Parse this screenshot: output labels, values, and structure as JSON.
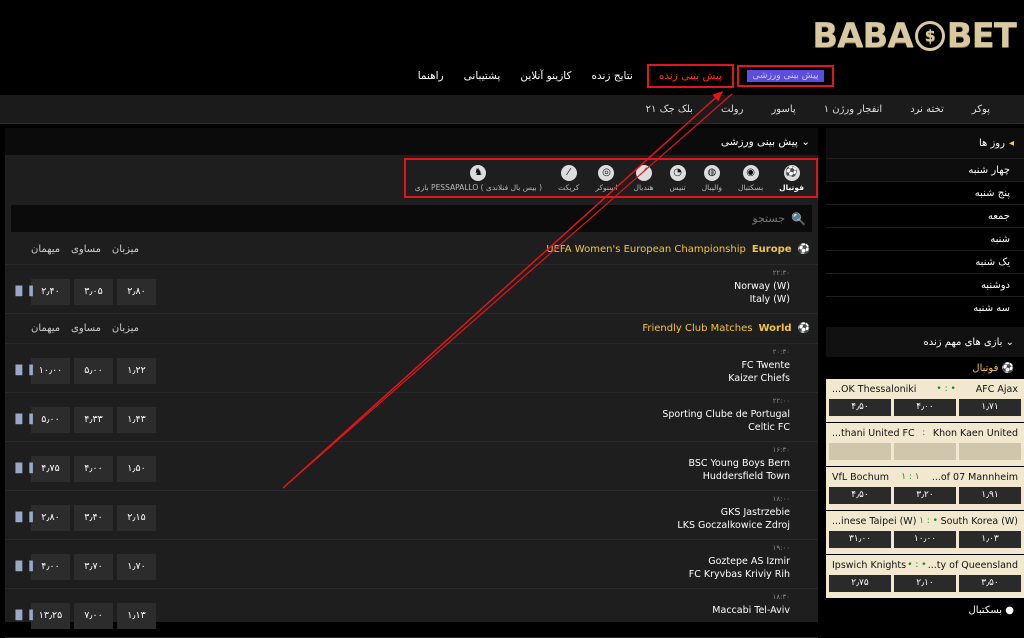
{
  "logo": {
    "left": "BABA",
    "coin": "$",
    "right": "BET"
  },
  "mainnav": {
    "sport": "پیش بینی ورزشی",
    "live": "پیش بینی زنده",
    "results": "نتایج زنده",
    "casino": "کازینو آنلاین",
    "support": "پشتیبانی",
    "help": "راهنما"
  },
  "subnav": [
    "پوکر",
    "تخته نرد",
    "انفجار ورژن ۱",
    "پاسور",
    "رولت",
    "بلک جک ۲۱"
  ],
  "sidebar": {
    "days_title": "روز ها",
    "days": [
      "چهار شنبه",
      "پنج شنبه",
      "جمعه",
      "شنبه",
      "یک شنبه",
      "دوشنبه",
      "سه شنبه"
    ],
    "live_title": "بازی های مهم زنده",
    "live_sport": "فوتبال",
    "live_matches": [
      {
        "home": "AFC Ajax",
        "score": "• : •",
        "away": "...OK Thessaloniki",
        "odds": [
          "۱٫۷۱",
          "۴٫۰۰",
          "۴٫۵۰"
        ]
      },
      {
        "home": "Khon Kaen United",
        "score": ":",
        "away": "...thani United FC",
        "odds": [
          "",
          "",
          ""
        ]
      },
      {
        "home": "...of 07 Mannheim",
        "score": "۱ : ۱",
        "away": "VfL Bochum",
        "odds": [
          "۱٫۹۱",
          "۳٫۲۰",
          "۴٫۵۰"
        ]
      },
      {
        "home": "South Korea (W)",
        "score": "۱ : •",
        "away": "...inese Taipei (W)",
        "odds": [
          "۱٫۰۳",
          "۱۰٫۰۰",
          "۳۱٫۰۰"
        ]
      },
      {
        "home": "...ty of Queensland",
        "score": "• : •",
        "away": "Ipswich Knights",
        "odds": [
          "۳٫۵۰",
          "۲٫۱۰",
          "۲٫۷۵"
        ]
      }
    ],
    "basketball": "بسکتبال"
  },
  "main": {
    "title": "پیش بینی ورزشی",
    "sports": [
      "فوتبال",
      "بسکتبال",
      "والیبال",
      "تنیس",
      "هندبال",
      "اسنوکر",
      "کریکت",
      "بازی PESSAPALLO ( بیس بال فنلاندی )"
    ],
    "search_placeholder": "جستجو",
    "col_home": "میزبان",
    "col_draw": "مساوی",
    "col_away": "میهمان",
    "leagues": [
      {
        "name": "UEFA Women's European Championship",
        "region": "Europe",
        "matches": [
          {
            "time": "۲۲:۳۰",
            "home": "Norway (W)",
            "away": "Italy (W)",
            "odds": [
              "۲٫۸۰",
              "۳٫۰۵",
              "۲٫۴۰"
            ]
          }
        ]
      },
      {
        "name": "Friendly Club Matches",
        "region": "World",
        "matches": [
          {
            "time": "۲۰:۳۰",
            "home": "FC Twente",
            "away": "Kaizer Chiefs",
            "odds": [
              "۱٫۲۲",
              "۵٫۰۰",
              "۱۰٫۰۰"
            ]
          },
          {
            "time": "۲۲:۰۰",
            "home": "Sporting Clube de Portugal",
            "away": "Celtic FC",
            "odds": [
              "۱٫۴۳",
              "۴٫۳۳",
              "۵٫۰۰"
            ]
          },
          {
            "time": "۱۶:۳۰",
            "home": "BSC Young Boys Bern",
            "away": "Huddersfield Town",
            "odds": [
              "۱٫۵۰",
              "۴٫۰۰",
              "۴٫۷۵"
            ]
          },
          {
            "time": "۱۸:۰۰",
            "home": "GKS Jastrzebie",
            "away": "LKS Goczalkowice Zdroj",
            "odds": [
              "۲٫۱۵",
              "۳٫۴۰",
              "۲٫۸۰"
            ]
          },
          {
            "time": "۱۹:۰۰",
            "home": "Goztepe AS Izmir",
            "away": "FC Kryvbas Kriviy Rih",
            "odds": [
              "۱٫۷۰",
              "۳٫۷۰",
              "۴٫۰۰"
            ]
          },
          {
            "time": "۱۸:۳۰",
            "home": "Maccabi Tel-Aviv",
            "away": "",
            "odds": [
              "۱٫۱۳",
              "۷٫۰۰",
              "۱۳٫۲۵"
            ]
          }
        ]
      }
    ]
  },
  "colors": {
    "accent_gold": "#f4c542",
    "highlight_red": "#e0161b",
    "live_bg": "#f1e8cf"
  }
}
